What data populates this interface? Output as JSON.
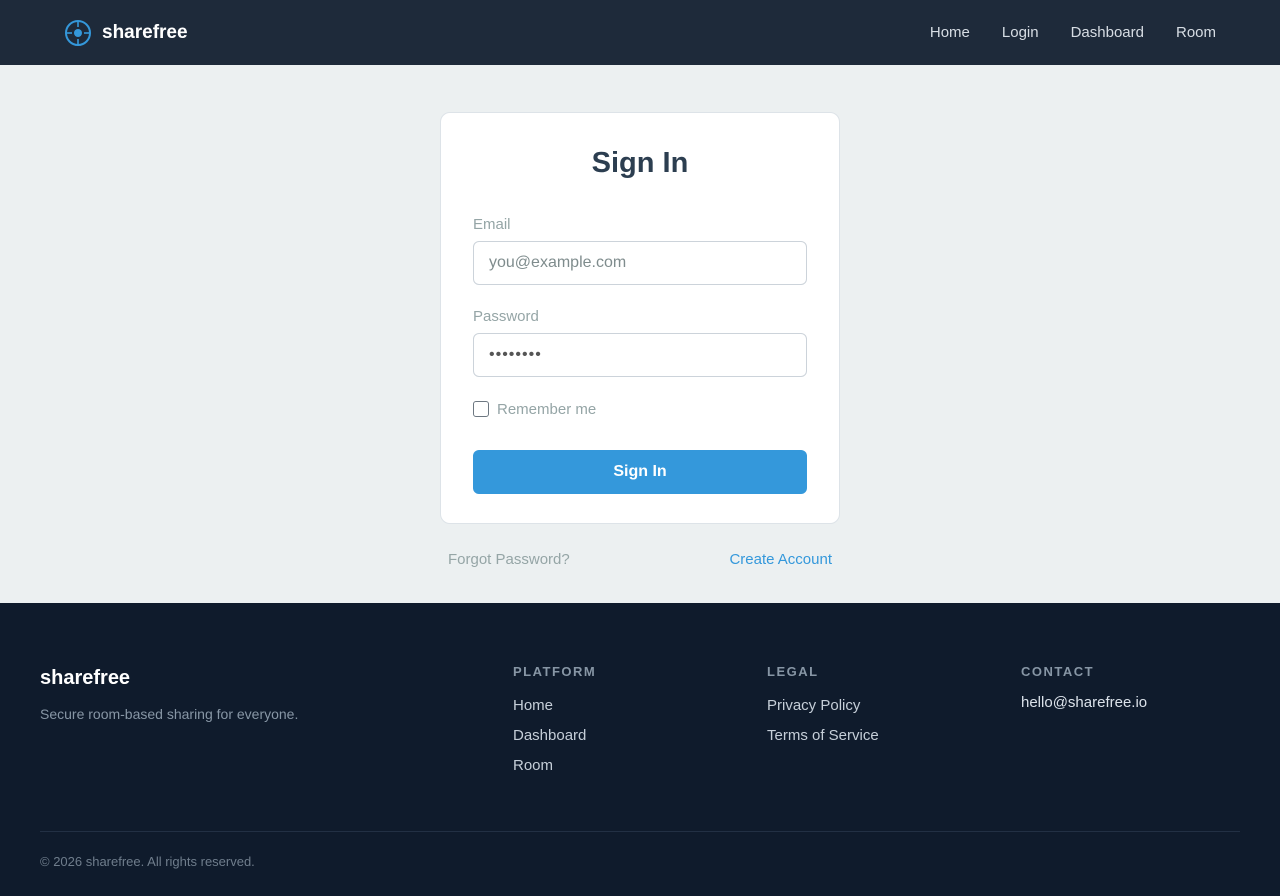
{
  "header": {
    "brand": "sharefree",
    "nav": [
      "Home",
      "Login",
      "Dashboard",
      "Room"
    ]
  },
  "signin": {
    "title": "Sign In",
    "email_label": "Email",
    "email_placeholder": "you@example.com",
    "password_label": "Password",
    "password_value": "••••••••",
    "remember_label": "Remember me",
    "remember_checked": false,
    "submit_label": "Sign In",
    "forgot_label": "Forgot Password?",
    "create_label": "Create Account"
  },
  "footer": {
    "brand": "sharefree",
    "tagline": "Secure room-based sharing for everyone.",
    "platform": {
      "heading": "PLATFORM",
      "links": [
        "Home",
        "Dashboard",
        "Room"
      ]
    },
    "legal": {
      "heading": "LEGAL",
      "links": [
        "Privacy Policy",
        "Terms of Service"
      ]
    },
    "contact": {
      "heading": "CONTACT",
      "email": "hello@sharefree.io"
    },
    "copyright": "© 2026 sharefree. All rights reserved."
  },
  "colors": {
    "header_bg": "#1e2a3a",
    "accent": "#3498db",
    "page_bg": "#ecf0f1",
    "footer_bg": "#0f1b2c"
  },
  "icons": {
    "brand": "target-crosshair-icon"
  }
}
